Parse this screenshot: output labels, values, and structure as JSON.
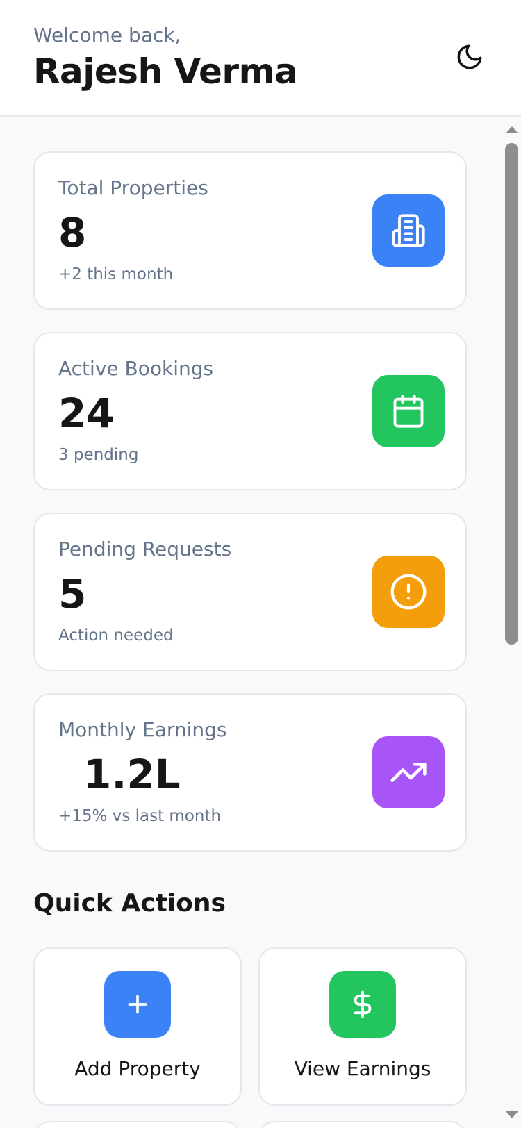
{
  "header": {
    "welcome": "Welcome back,",
    "user_name": "Rajesh Verma",
    "theme_icon": "moon-icon"
  },
  "stats": [
    {
      "label": "Total Properties",
      "value": "8",
      "sub": "+2 this month",
      "icon": "building-icon",
      "color": "#3b82f6"
    },
    {
      "label": "Active Bookings",
      "value": "24",
      "sub": "3 pending",
      "icon": "calendar-icon",
      "color": "#22c55e"
    },
    {
      "label": "Pending Requests",
      "value": "5",
      "sub": "Action needed",
      "icon": "alert-circle-icon",
      "color": "#f59e0b"
    },
    {
      "label": "Monthly Earnings",
      "value": "1.2L",
      "sub": "+15% vs last month",
      "icon": "trending-up-icon",
      "color": "#a855f7"
    }
  ],
  "quick_actions": {
    "title": "Quick Actions",
    "items": [
      {
        "label": "Add Property",
        "icon": "plus-icon",
        "color": "#3b82f6"
      },
      {
        "label": "View Earnings",
        "icon": "dollar-icon",
        "color": "#22c55e"
      }
    ]
  }
}
